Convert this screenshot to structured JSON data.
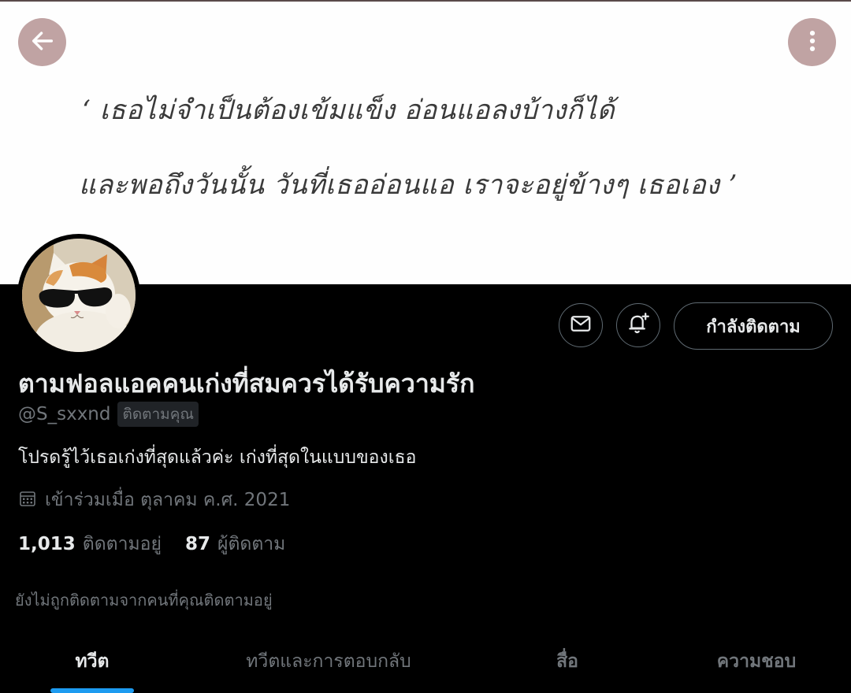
{
  "banner": {
    "line1": "‘ เธอไม่จำเป็นต้องเข้มแข็ง อ่อนแอลงบ้างก็ได้",
    "line2": "และพอถึงวันนั้น วันที่เธออ่อนแอ เราจะอยู่ข้างๆ เธอเอง ’"
  },
  "header": {
    "back_icon": "arrow-left-icon",
    "more_icon": "vertical-ellipsis-icon",
    "button_color": "#c0a3a3"
  },
  "profile": {
    "display_name": "ตามฟอลแอคคนเก่งที่สมควรได้รับความรัก",
    "handle": "@S_sxxnd",
    "follows_you": "ติดตามคุณ",
    "bio": "โปรดรู้ไว้เธอเก่งที่สุดแล้วค่ะ เก่งที่สุดในแบบของเธอ",
    "joined": "เข้าร่วมเมื่อ ตุลาคม ค.ศ. 2021",
    "following_count": "1,013",
    "following_label": "ติดตามอยู่",
    "followers_count": "87",
    "followers_label": "ผู้ติดตาม",
    "not_followed_note": "ยังไม่ถูกติดตามจากคนที่คุณติดตามอยู่"
  },
  "actions": {
    "message_icon": "envelope-icon",
    "notify_icon": "bell-plus-icon",
    "following_button": "กำลังติดตาม"
  },
  "tabs": [
    {
      "label": "ทวีต",
      "active": true
    },
    {
      "label": "ทวีตและการตอบกลับ",
      "active": false
    },
    {
      "label": "สื่อ",
      "active": false
    },
    {
      "label": "ความชอบ",
      "active": false
    }
  ],
  "colors": {
    "accent": "#1d9bf0",
    "background": "#000000",
    "muted_text": "#71767b"
  }
}
